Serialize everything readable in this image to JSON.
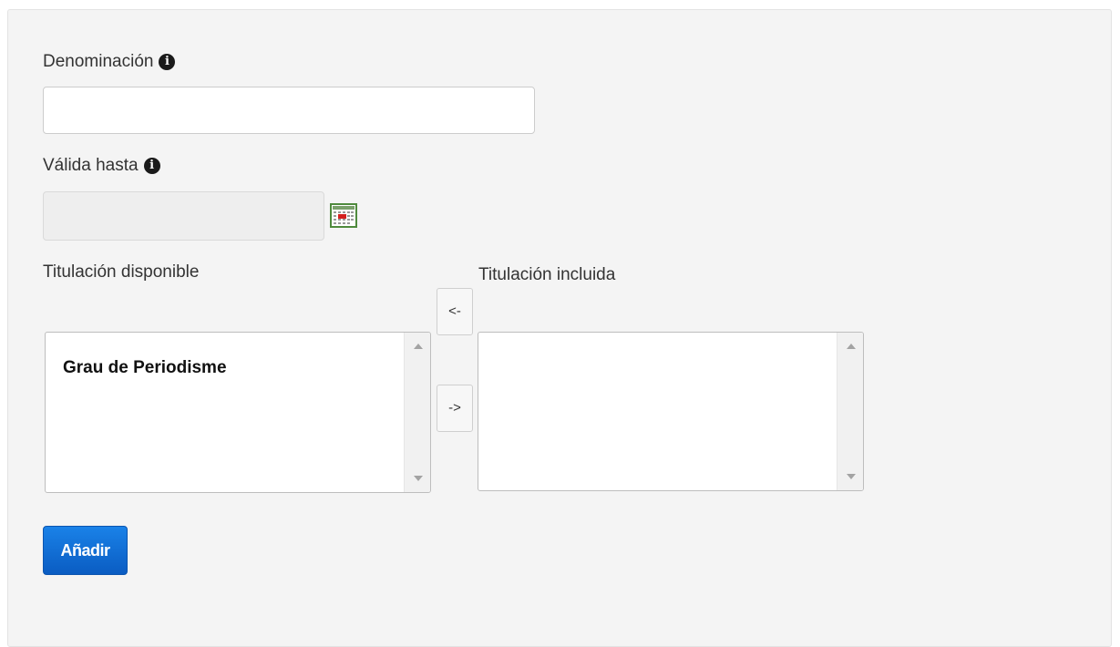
{
  "form": {
    "denominacion": {
      "label": "Denominación",
      "value": "",
      "info_icon": "info-icon"
    },
    "valida_hasta": {
      "label": "Válida hasta",
      "value": "",
      "info_icon": "info-icon",
      "calendar_icon": "calendar-icon"
    },
    "titulacion_disponible": {
      "label": "Titulación disponible",
      "options": [
        "Grau de Periodisme"
      ]
    },
    "titulacion_incluida": {
      "label": "Titulación incluida",
      "options": []
    },
    "move_left_label": "<-",
    "move_right_label": "->",
    "submit_label": "Añadir"
  },
  "colors": {
    "panel_bg": "#f4f4f4",
    "primary": "#0a6ad8",
    "calendar_border": "#4f8a3d"
  }
}
